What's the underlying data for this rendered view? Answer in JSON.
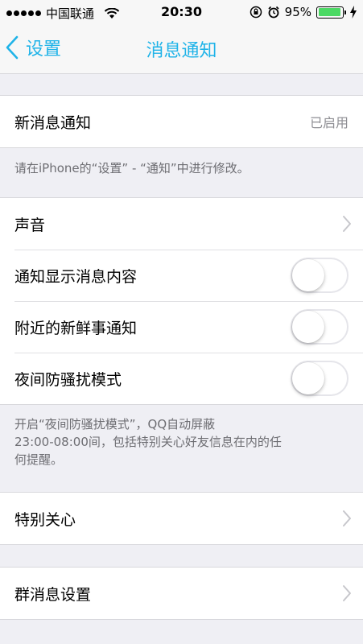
{
  "status_bar": {
    "carrier": "中国联通",
    "time": "20:30",
    "battery_percent": "95%",
    "battery_level": 0.95
  },
  "nav": {
    "back_label": "设置",
    "title": "消息通知"
  },
  "sections": {
    "new_message": {
      "label": "新消息通知",
      "value": "已启用",
      "note": "请在iPhone的“设置” - “通知”中进行修改。"
    },
    "options": [
      {
        "label": "声音",
        "control": "chevron"
      },
      {
        "label": "通知显示消息内容",
        "control": "toggle",
        "on": false
      },
      {
        "label": "附近的新鲜事通知",
        "control": "toggle",
        "on": false
      },
      {
        "label": "夜间防骚扰模式",
        "control": "toggle",
        "on": false
      }
    ],
    "night_mode_note": "开启“夜间防骚扰模式”，QQ自动屏蔽\n23:00-08:00间，包括特别关心好友信息在内的任\n何提醒。",
    "special_care": {
      "label": "特别关心"
    },
    "group_settings": {
      "label": "群消息设置"
    }
  },
  "colors": {
    "accent": "#1fb3e8",
    "battery": "#4cd964",
    "background": "#efeff4"
  },
  "icons": [
    "signal-icon",
    "wifi-icon",
    "lock-rotation-icon",
    "alarm-icon",
    "battery-icon",
    "charging-icon",
    "chevron-left-icon",
    "chevron-right-icon"
  ]
}
